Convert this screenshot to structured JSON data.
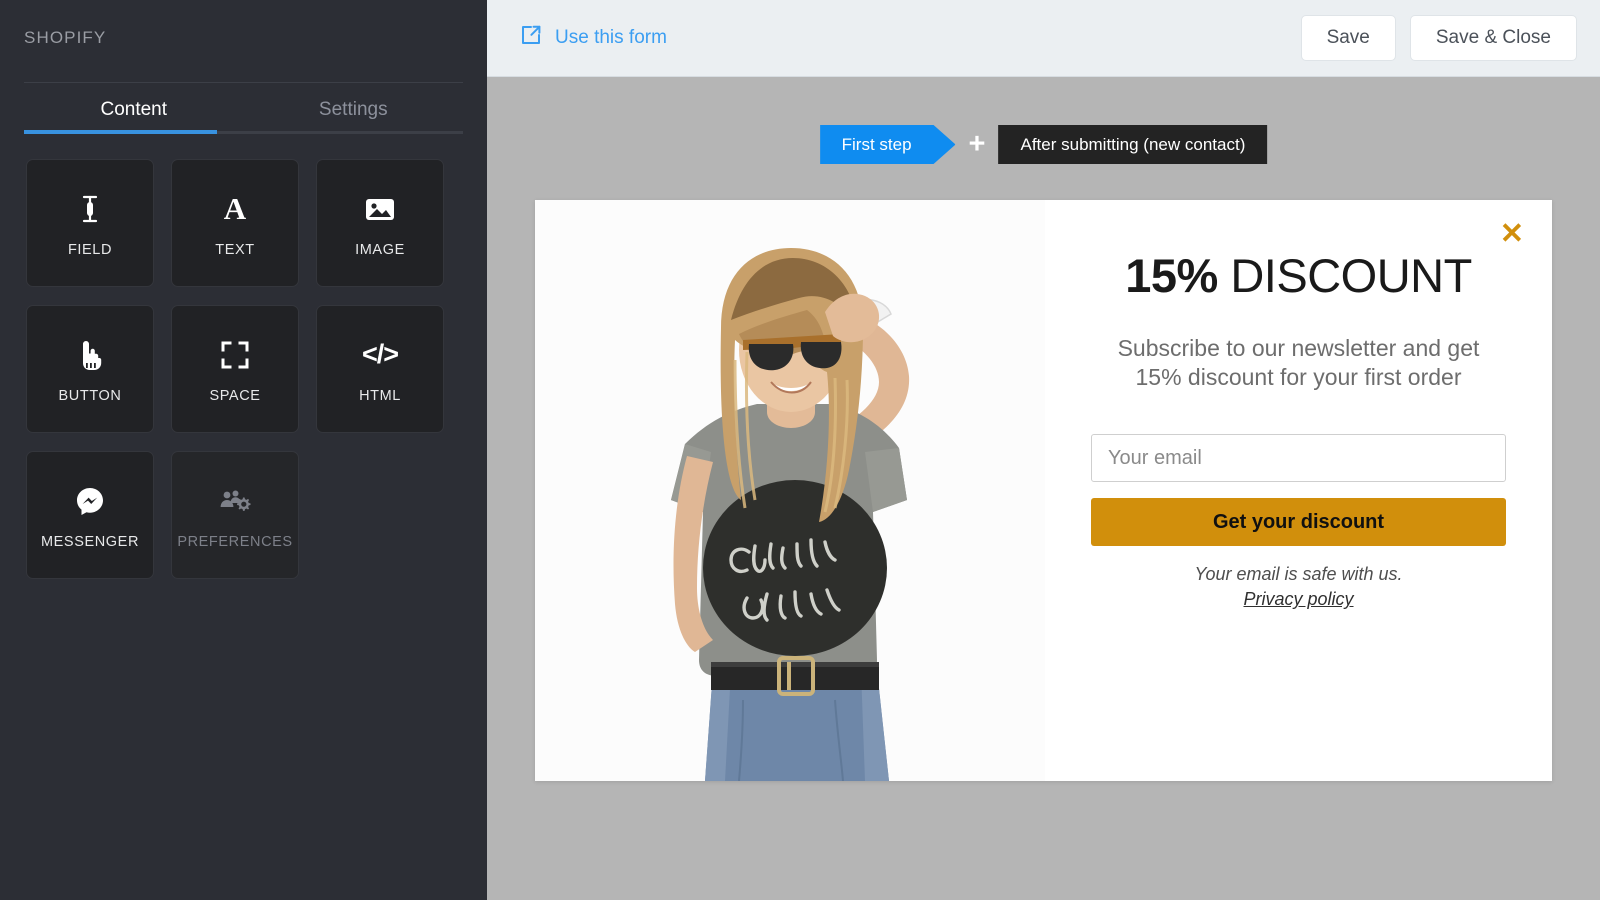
{
  "sidebar": {
    "brand": "SHOPIFY",
    "tabs": [
      {
        "label": "Content",
        "active": true
      },
      {
        "label": "Settings",
        "active": false
      }
    ],
    "tiles": [
      {
        "label": "FIELD",
        "icon": "text-cursor-icon",
        "disabled": false
      },
      {
        "label": "TEXT",
        "icon": "letter-a-icon",
        "disabled": false
      },
      {
        "label": "IMAGE",
        "icon": "image-icon",
        "disabled": false
      },
      {
        "label": "BUTTON",
        "icon": "pointing-hand-icon",
        "disabled": false
      },
      {
        "label": "SPACE",
        "icon": "expand-frame-icon",
        "disabled": false
      },
      {
        "label": "HTML",
        "icon": "code-brackets-icon",
        "disabled": false
      },
      {
        "label": "MESSENGER",
        "icon": "messenger-icon",
        "disabled": false
      },
      {
        "label": "PREFERENCES",
        "icon": "people-gear-icon",
        "disabled": true
      }
    ]
  },
  "topbar": {
    "use_form_label": "Use this form",
    "use_form_icon": "external-link-icon",
    "save_label": "Save",
    "save_close_label": "Save & Close"
  },
  "steps": {
    "first": "First step",
    "add_icon": "plus-icon",
    "after": "After submitting (new contact)"
  },
  "popup": {
    "close_icon": "close-x-icon",
    "headline_strong": "15%",
    "headline_rest": " DISCOUNT",
    "subline_line1": "Subscribe to our newsletter and get",
    "subline_line2": "15% discount for your first order",
    "email_placeholder": "Your email",
    "email_value": "",
    "cta_label": "Get your discount",
    "safe_note": "Your email is safe with us.",
    "privacy_label": "Privacy policy",
    "photo_alt": "Woman in gray Culprit Apparel t-shirt with sunglasses"
  },
  "colors": {
    "accent_blue": "#0f8cf0",
    "accent_orange": "#d18f0c",
    "sidebar_bg": "#2c2e35",
    "tile_bg": "#212225",
    "topbar_bg": "#ebeff2",
    "canvas_bg": "#b5b5b5",
    "step_dark": "#232323"
  }
}
